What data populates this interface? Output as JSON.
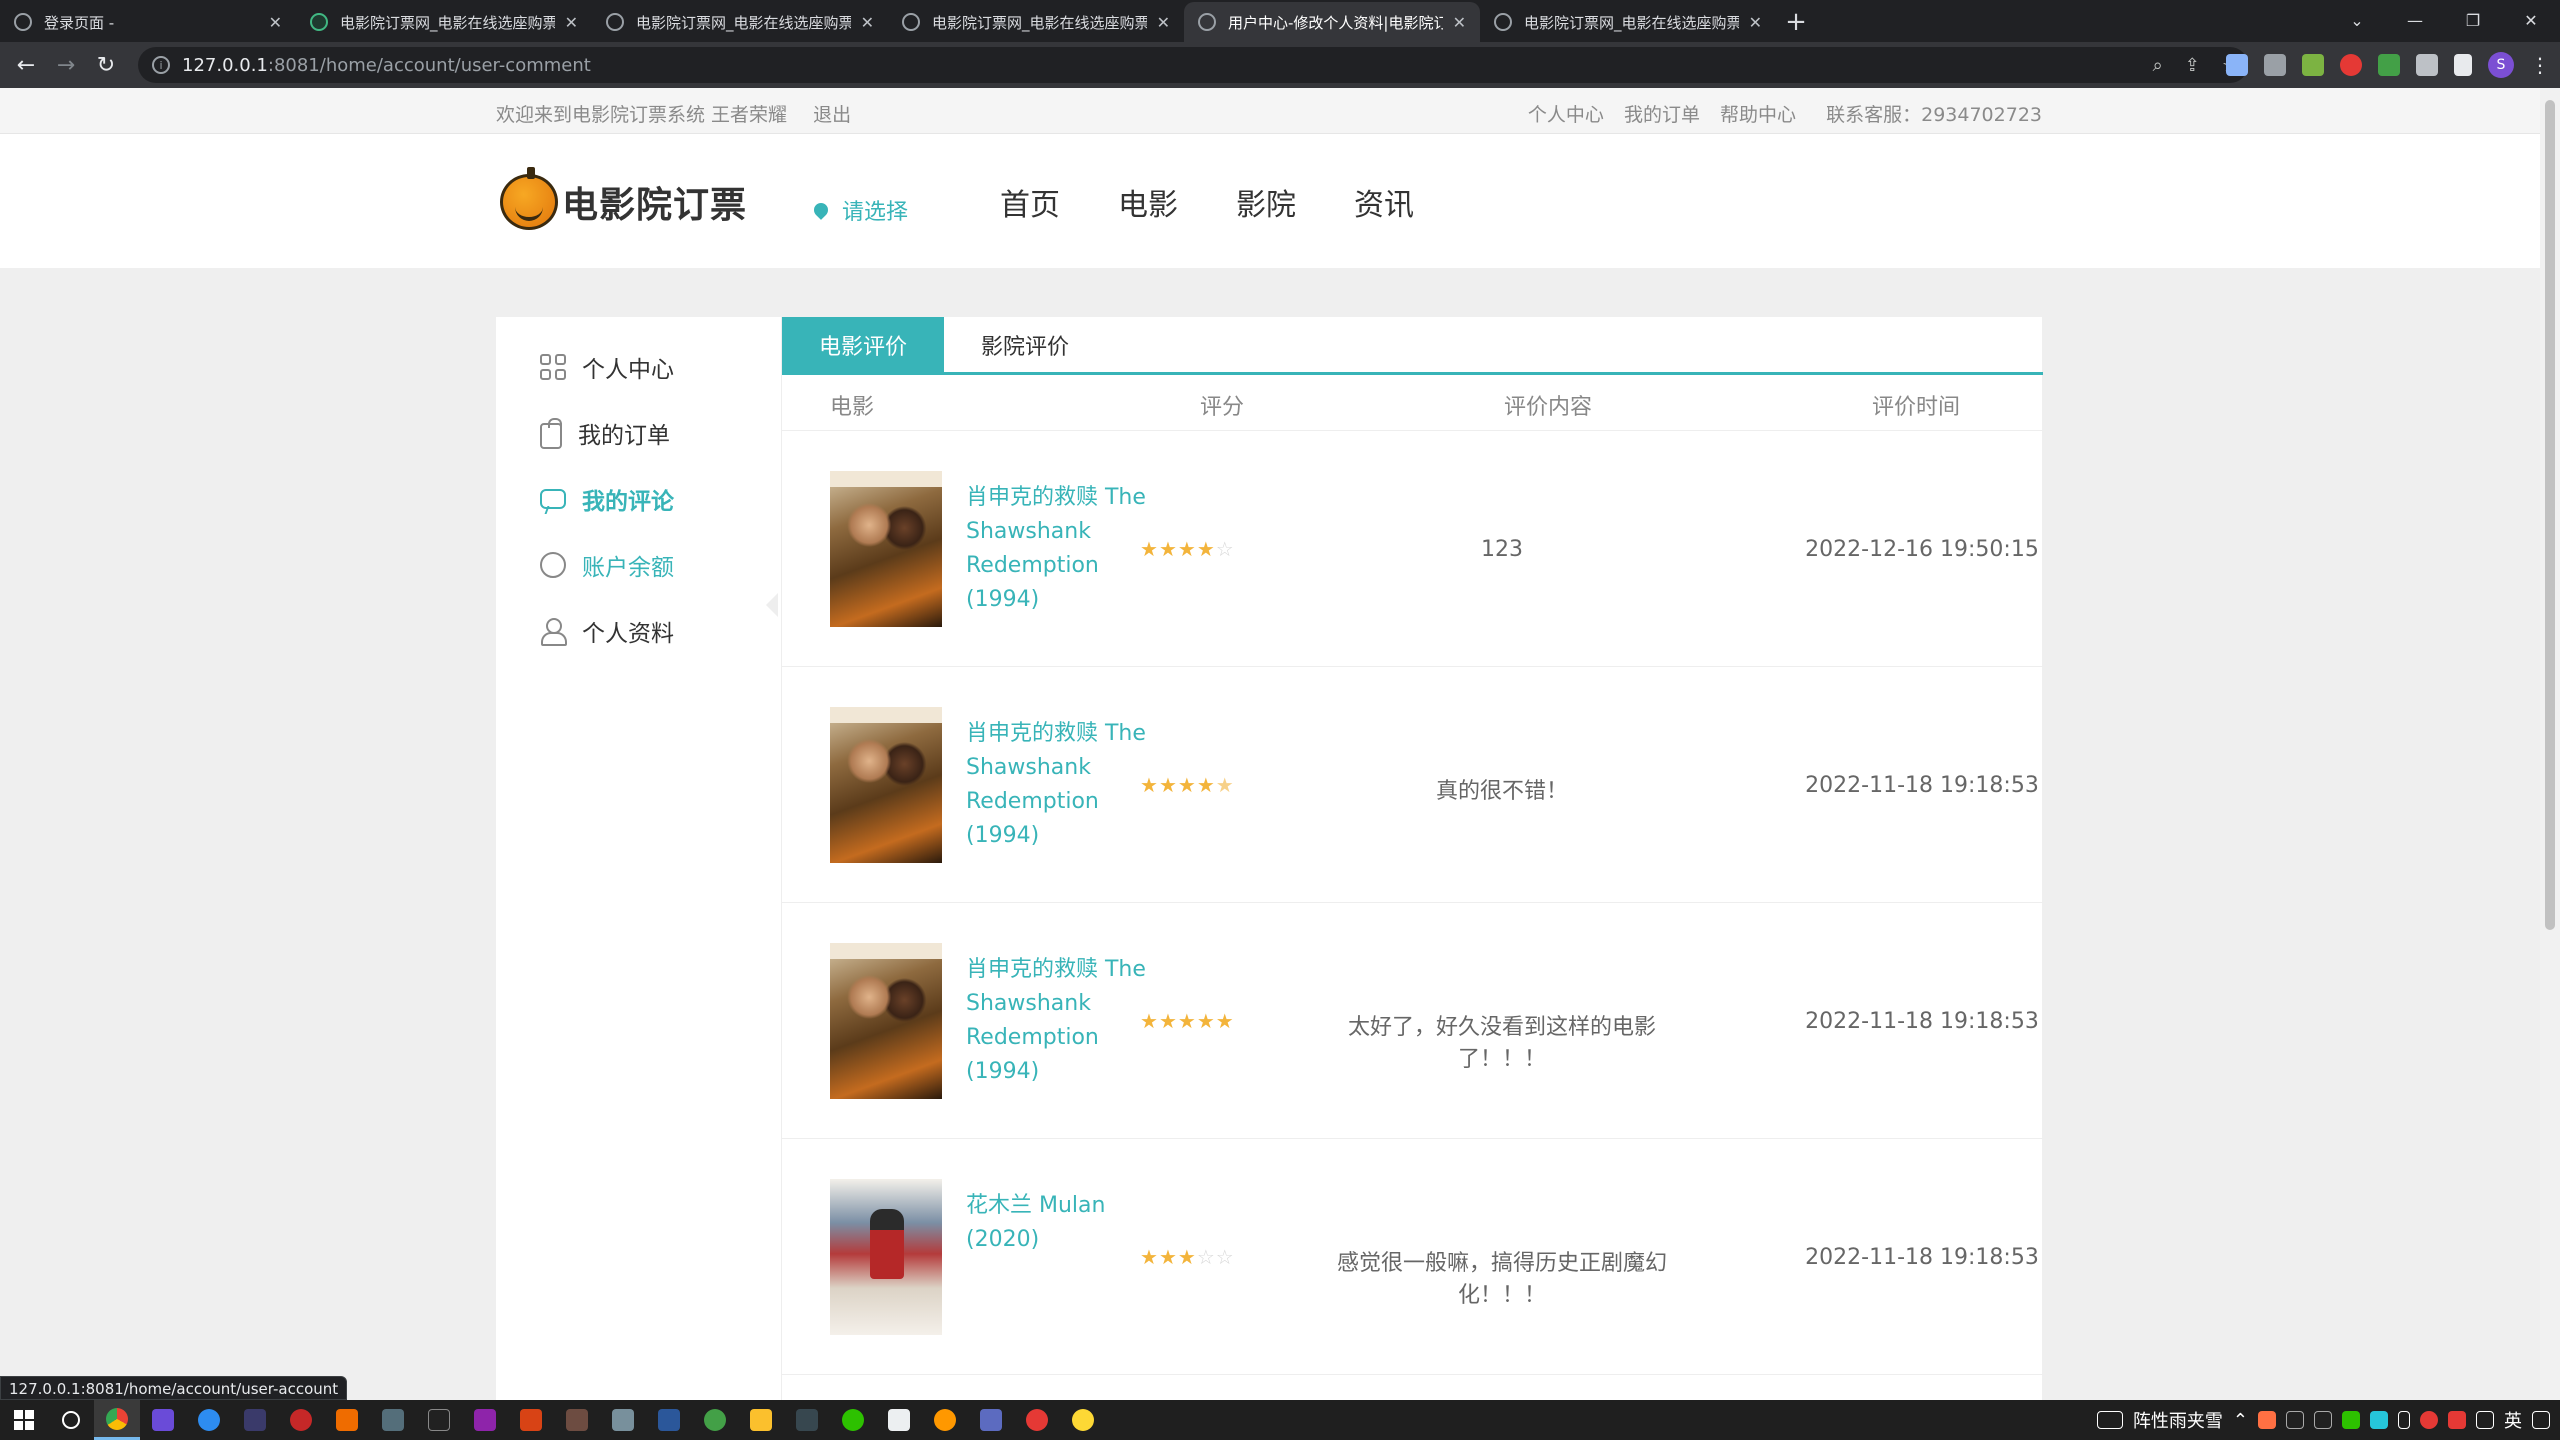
{
  "browser": {
    "tabs": [
      {
        "title": "登录页面 -",
        "active": false,
        "icon": "globe-icon"
      },
      {
        "title": "电影院订票网_电影在线选座购票",
        "active": false,
        "icon": "vue-icon"
      },
      {
        "title": "电影院订票网_电影在线选座购票",
        "active": false,
        "icon": "globe-icon"
      },
      {
        "title": "电影院订票网_电影在线选座购票",
        "active": false,
        "icon": "globe-icon"
      },
      {
        "title": "用户中心-修改个人资料|电影院订",
        "active": true,
        "icon": "globe-icon"
      },
      {
        "title": "电影院订票网_电影在线选座购票",
        "active": false,
        "icon": "globe-icon"
      }
    ],
    "url_host": "127.0.0.1",
    "url_path": ":8081/home/account/user-comment",
    "profile_initial": "S",
    "status_url": "127.0.0.1:8081/home/account/user-account"
  },
  "site": {
    "topbar": {
      "welcome": "欢迎来到电影院订票系统",
      "username": "王者荣耀",
      "logout": "退出",
      "links": [
        "个人中心",
        "我的订单",
        "帮助中心"
      ],
      "service": "联系客服：2934702723"
    },
    "logo_text": "电影院订票",
    "city": "请选择",
    "nav": [
      "首页",
      "电影",
      "影院",
      "资讯"
    ]
  },
  "sidebar": {
    "items": [
      {
        "label": "个人中心",
        "icon": "grid-icon"
      },
      {
        "label": "我的订单",
        "icon": "bag-icon"
      },
      {
        "label": "我的评论",
        "icon": "comment-icon"
      },
      {
        "label": "账户余额",
        "icon": "money-icon"
      },
      {
        "label": "个人资料",
        "icon": "user-icon"
      }
    ]
  },
  "tabs": {
    "movie": "电影评价",
    "cinema": "影院评价"
  },
  "table": {
    "headers": {
      "movie": "电影",
      "score": "评分",
      "content": "评价内容",
      "time": "评价时间"
    },
    "rows": [
      {
        "movie": "肖申克的救赎 The Shawshank Redemption (1994)",
        "rating": 4,
        "content": "123",
        "time": "2022-12-16 19:50:15",
        "poster": "shawshank"
      },
      {
        "movie": "肖申克的救赎 The Shawshank Redemption (1994)",
        "rating": 4.5,
        "content": "真的很不错！",
        "time": "2022-11-18 19:18:53",
        "poster": "shawshank"
      },
      {
        "movie": "肖申克的救赎 The Shawshank Redemption (1994)",
        "rating": 5,
        "content": "太好了，好久没看到这样的电影了！！！",
        "time": "2022-11-18 19:18:53",
        "poster": "shawshank"
      },
      {
        "movie": "花木兰 Mulan (2020)",
        "rating": 3,
        "content": "感觉很一般嘛，搞得历史正剧魔幻化！！！",
        "time": "2022-11-18 19:18:53",
        "poster": "mulan"
      }
    ]
  },
  "taskbar": {
    "ime_text": "阵性雨夹雪",
    "lang": "英"
  },
  "colors": {
    "accent": "#38b4b8",
    "star": "#f3b43b"
  }
}
